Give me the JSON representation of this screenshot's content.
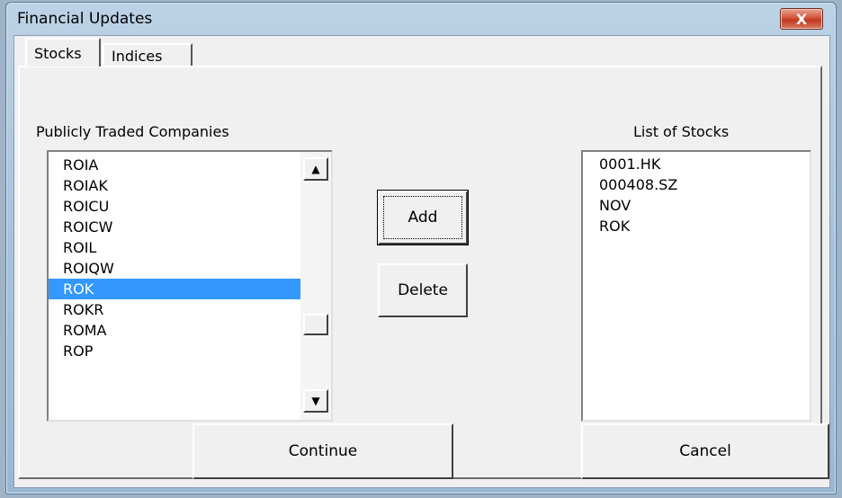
{
  "window": {
    "title": "Financial Updates",
    "close_label": "X"
  },
  "tabs": [
    {
      "label": "Stocks",
      "active": true
    },
    {
      "label": "Indices",
      "active": false
    }
  ],
  "companies": {
    "label": "Publicly Traded Companies",
    "items": [
      "ROIA",
      "ROIAK",
      "ROICU",
      "ROICW",
      "ROIL",
      "ROIQW",
      "ROK",
      "ROKR",
      "ROMA",
      "ROP"
    ],
    "selected": "ROK"
  },
  "stocks": {
    "label": "List of Stocks",
    "items": [
      "0001.HK",
      "000408.SZ",
      "NOV",
      "ROK"
    ]
  },
  "buttons": {
    "add": "Add",
    "delete": "Delete",
    "continue": "Continue",
    "cancel": "Cancel"
  },
  "icons": {
    "scroll_up": "▲",
    "scroll_down": "▼"
  }
}
